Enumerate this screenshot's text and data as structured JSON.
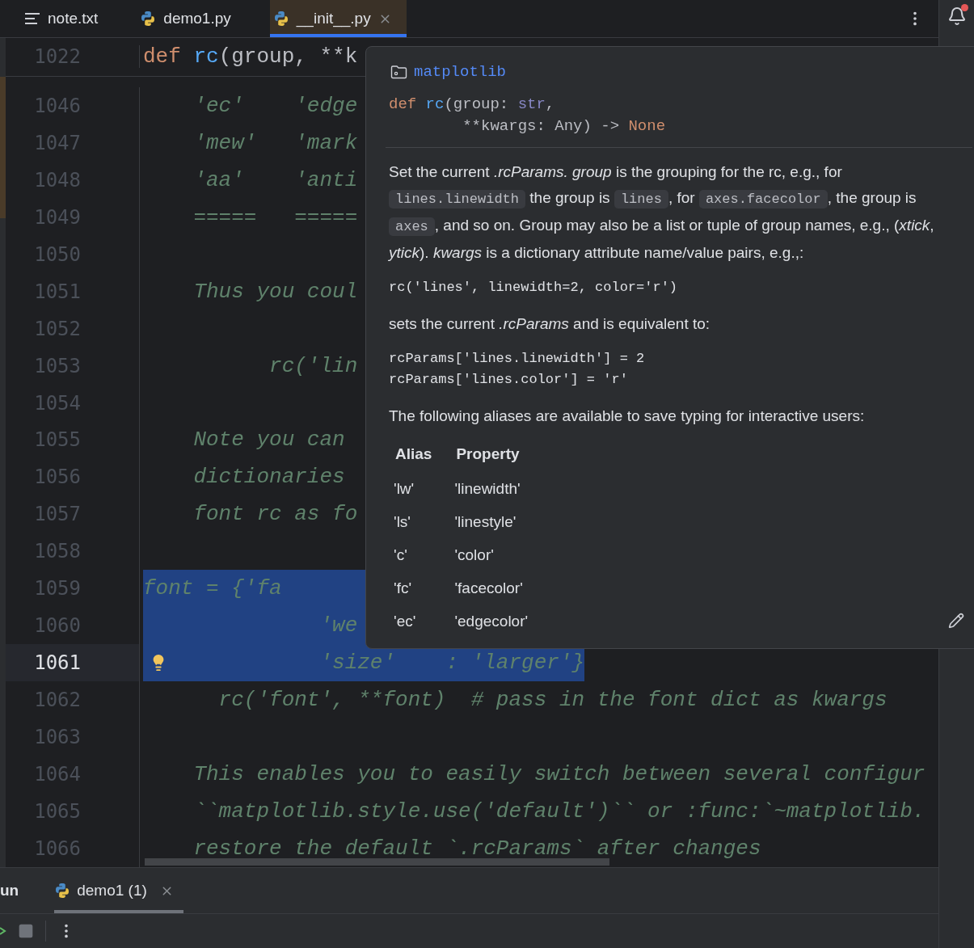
{
  "tabs": [
    {
      "label": "note.txt",
      "kind": "text",
      "selected": false
    },
    {
      "label": "demo1.py",
      "kind": "python",
      "selected": false
    },
    {
      "label": "__init__.py",
      "kind": "python",
      "selected": true
    }
  ],
  "sticky_line": {
    "number": "1022",
    "tokens": [
      {
        "text": "def ",
        "kind": "keyword"
      },
      {
        "text": "rc",
        "kind": "function"
      },
      {
        "text": "(group, **k",
        "kind": "plain"
      }
    ]
  },
  "lines": [
    {
      "number": "1046",
      "text": "    'ec'    'edge",
      "kind": "plain",
      "current": false
    },
    {
      "number": "1047",
      "text": "    'mew'   'mark",
      "kind": "plain",
      "current": false
    },
    {
      "number": "1048",
      "text": "    'aa'    'anti",
      "kind": "plain",
      "current": false
    },
    {
      "number": "1049",
      "text": "    =====   =====",
      "kind": "plain",
      "current": false
    },
    {
      "number": "1050",
      "kind": "plain",
      "current": false
    },
    {
      "number": "1051",
      "text": "    Thus you coul",
      "kind": "plain",
      "current": false
    },
    {
      "number": "1052",
      "kind": "plain",
      "current": false
    },
    {
      "number": "1053",
      "text": "          rc('lin",
      "kind": "plain",
      "current": false
    },
    {
      "number": "1054",
      "kind": "plain",
      "current": false
    },
    {
      "number": "1055",
      "text": "    Note you can",
      "kind": "plain",
      "current": false
    },
    {
      "number": "1056",
      "text": "    dictionaries",
      "kind": "plain",
      "current": false
    },
    {
      "number": "1057",
      "text": "    font rc as fo",
      "kind": "plain",
      "current": false
    },
    {
      "number": "1058",
      "kind": "plain",
      "current": false
    },
    {
      "number": "1059",
      "text": "      font = {'fa",
      "kind": "tail",
      "current": false
    },
    {
      "number": "1060",
      "text": "              'we",
      "kind": "full",
      "current": false
    },
    {
      "number": "1061",
      "text": "              'size'    : 'larger'}",
      "kind": "head",
      "current": true
    },
    {
      "number": "1062",
      "text": "      rc('font', **font)  # pass in the font dict as kwargs",
      "kind": "plain",
      "current": false
    },
    {
      "number": "1063",
      "kind": "plain",
      "current": false
    },
    {
      "number": "1064",
      "text": "    This enables you to easily switch between several configur",
      "kind": "plain",
      "current": false
    },
    {
      "number": "1065",
      "text": "    ``matplotlib.style.use('default')`` or :func:`~matplotlib.",
      "kind": "plain",
      "current": false
    },
    {
      "number": "1066",
      "text": "    restore the default `.rcParams` after changes",
      "kind": "plain",
      "current": false
    }
  ],
  "quick_doc": {
    "module": "matplotlib",
    "signature": [
      [
        {
          "text": "def ",
          "kind": "keyword"
        },
        {
          "text": "rc",
          "kind": "function"
        },
        {
          "text": "(group: ",
          "kind": "plain"
        },
        {
          "text": "str",
          "kind": "type"
        },
        {
          "text": ",",
          "kind": "plain"
        }
      ],
      [
        {
          "text": "        **kwargs: Any) -> ",
          "kind": "plain"
        },
        {
          "text": "None",
          "kind": "keyword"
        }
      ]
    ],
    "blocks": [
      {
        "kind": "paragraph",
        "segments": [
          {
            "kind": "text",
            "text": "Set the current *.rcParams. group* is the grouping for the rc, e.g., for "
          },
          {
            "kind": "code",
            "text": "lines.linewidth"
          },
          {
            "kind": "text",
            "text": " the group is "
          },
          {
            "kind": "code",
            "text": "lines"
          },
          {
            "kind": "text",
            "text": ", for "
          },
          {
            "kind": "code",
            "text": "axes.facecolor"
          },
          {
            "kind": "text",
            "text": ", the group is "
          },
          {
            "kind": "code",
            "text": "axes"
          },
          {
            "kind": "text",
            "text": ", and so on. Group may also be a list or tuple of group names, e.g., (*xtick*, *ytick*). *kwargs* is a dictionary attribute name/value pairs, e.g.,:"
          }
        ]
      },
      {
        "kind": "code",
        "lines": [
          "rc('lines', linewidth=2, color='r')"
        ]
      },
      {
        "kind": "paragraph",
        "segments": [
          {
            "kind": "text",
            "text": "sets the current *.rcParams* and is equivalent to:"
          }
        ]
      },
      {
        "kind": "code",
        "lines": [
          "rcParams['lines.linewidth'] = 2",
          "rcParams['lines.color'] = 'r'"
        ]
      },
      {
        "kind": "paragraph",
        "segments": [
          {
            "kind": "text",
            "text": "The following aliases are available to save typing for interactive users:"
          }
        ]
      },
      {
        "kind": "table",
        "columns": [
          "Alias",
          "Property"
        ],
        "rows": [
          [
            "'lw'",
            "'linewidth'"
          ],
          [
            "'ls'",
            "'linestyle'"
          ],
          [
            "'c'",
            "'color'"
          ],
          [
            "'fc'",
            "'facecolor'"
          ],
          [
            "'ec'",
            "'edgecolor'"
          ]
        ]
      }
    ]
  },
  "run_panel": {
    "title": "un",
    "tabs": [
      {
        "label": "demo1 (1)",
        "selected": true
      }
    ]
  }
}
